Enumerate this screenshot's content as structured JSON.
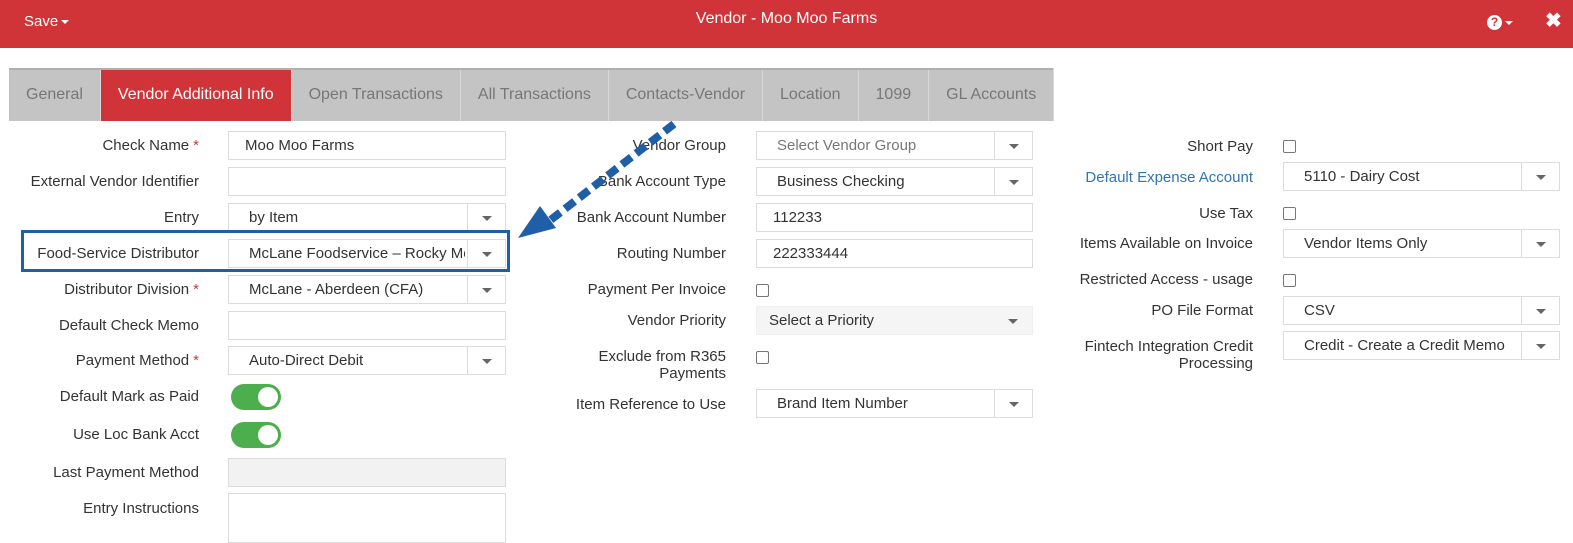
{
  "header": {
    "save_label": "Save",
    "title": "Vendor - Moo Moo Farms",
    "help_glyph": "?",
    "close_glyph": "✖",
    "bar_color": "#d13438"
  },
  "tabs": [
    {
      "label": "General",
      "active": false
    },
    {
      "label": "Vendor Additional Info",
      "active": true
    },
    {
      "label": "Open Transactions",
      "active": false
    },
    {
      "label": "All Transactions",
      "active": false
    },
    {
      "label": "Contacts-Vendor",
      "active": false
    },
    {
      "label": "Location",
      "active": false
    },
    {
      "label": "1099",
      "active": false
    },
    {
      "label": "GL Accounts",
      "active": false
    }
  ],
  "left": {
    "check_name": {
      "label": "Check Name",
      "value": "Moo Moo Farms",
      "required": "*"
    },
    "external_vendor_identifier": {
      "label": "External Vendor Identifier",
      "value": ""
    },
    "entry": {
      "label": "Entry",
      "value": "by Item"
    },
    "food_service_distributor": {
      "label": "Food-Service Distributor",
      "value": "McLane Foodservice – Rocky Mountain"
    },
    "distributor_division": {
      "label": "Distributor Division",
      "value": "McLane - Aberdeen (CFA)",
      "required": "*"
    },
    "default_check_memo": {
      "label": "Default Check Memo",
      "value": ""
    },
    "payment_method": {
      "label": "Payment Method",
      "value": "Auto-Direct Debit",
      "required": "*"
    },
    "default_mark_as_paid": {
      "label": "Default Mark as Paid",
      "on": true
    },
    "use_loc_bank_acct": {
      "label": "Use Loc Bank Acct",
      "on": true
    },
    "last_payment_method": {
      "label": "Last Payment Method",
      "value": ""
    },
    "entry_instructions": {
      "label": "Entry Instructions",
      "value": ""
    }
  },
  "middle": {
    "vendor_group": {
      "label": "Vendor Group",
      "placeholder": "Select Vendor Group"
    },
    "bank_account_type": {
      "label": "Bank Account Type",
      "value": "Business Checking"
    },
    "bank_account_number": {
      "label": "Bank Account Number",
      "value": "112233"
    },
    "routing_number": {
      "label": "Routing Number",
      "value": "222333444"
    },
    "payment_per_invoice": {
      "label": "Payment Per Invoice",
      "checked": false
    },
    "vendor_priority": {
      "label": "Vendor Priority",
      "placeholder": "Select a Priority"
    },
    "exclude_from_r365": {
      "label_line1": "Exclude from R365",
      "label_line2": "Payments",
      "checked": false
    },
    "item_reference_to_use": {
      "label": "Item Reference to Use",
      "value": "Brand Item Number"
    }
  },
  "right": {
    "short_pay": {
      "label": "Short Pay",
      "checked": false
    },
    "default_expense_account": {
      "label": "Default Expense Account",
      "value": "5110 - Dairy Cost"
    },
    "use_tax": {
      "label": "Use Tax",
      "checked": false
    },
    "items_available_on_invoice": {
      "label": "Items Available on Invoice",
      "value": "Vendor Items Only"
    },
    "restricted_access_usage": {
      "label": "Restricted Access - usage",
      "checked": false
    },
    "po_file_format": {
      "label": "PO File Format",
      "value": "CSV"
    },
    "fintech_integration_credit_processing": {
      "label_line1": "Fintech Integration Credit",
      "label_line2": "Processing",
      "value": "Credit - Create a Credit Memo"
    }
  },
  "colors": {
    "accent": "#d13438",
    "toggle_on": "#4cae4c",
    "highlight": "#1f5fa8",
    "link": "#2f75b5"
  }
}
